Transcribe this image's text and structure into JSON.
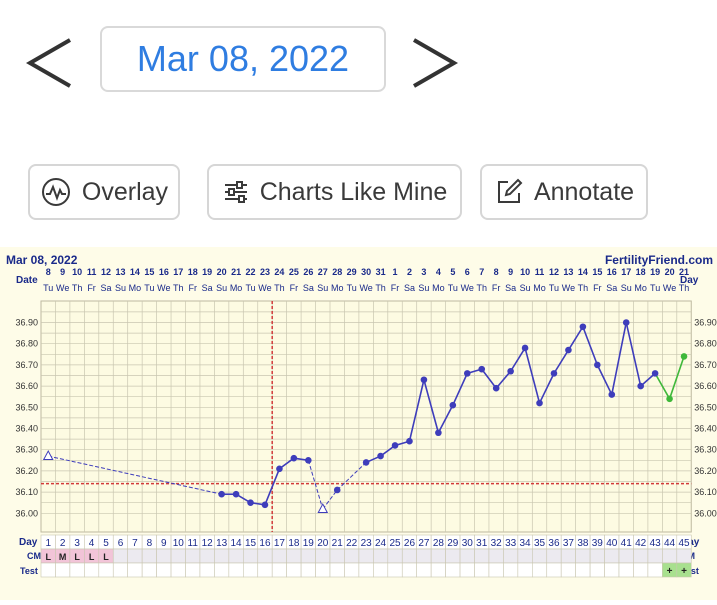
{
  "header": {
    "date": "Mar 08, 2022",
    "prev_icon": "chevron-left-icon",
    "next_icon": "chevron-right-icon"
  },
  "toolbar": {
    "overlay_label": "Overlay",
    "charts_like_mine_label": "Charts Like Mine",
    "annotate_label": "Annotate"
  },
  "chart_data": {
    "type": "line",
    "title": "Mar 08, 2022",
    "brand": "FertilityFriend.com",
    "row_labels": {
      "date": "Date",
      "day": "Day",
      "cm": "CM",
      "test": "Test"
    },
    "dates": [
      "8",
      "9",
      "10",
      "11",
      "12",
      "13",
      "14",
      "15",
      "16",
      "17",
      "18",
      "19",
      "20",
      "21",
      "22",
      "23",
      "24",
      "25",
      "26",
      "27",
      "28",
      "29",
      "30",
      "31",
      "1",
      "2",
      "3",
      "4",
      "5",
      "6",
      "7",
      "8",
      "9",
      "10",
      "11",
      "12",
      "13",
      "14",
      "15",
      "16",
      "17",
      "18",
      "19",
      "20",
      "21"
    ],
    "weekdays": [
      "Tu",
      "We",
      "Th",
      "Fr",
      "Sa",
      "Su",
      "Mo",
      "Tu",
      "We",
      "Th",
      "Fr",
      "Sa",
      "Su",
      "Mo",
      "Tu",
      "We",
      "Th",
      "Fr",
      "Sa",
      "Su",
      "Mo",
      "Tu",
      "We",
      "Th",
      "Fr",
      "Sa",
      "Su",
      "Mo",
      "Tu",
      "We",
      "Th",
      "Fr",
      "Sa",
      "Su",
      "Mo",
      "Tu",
      "We",
      "Th",
      "Fr",
      "Sa",
      "Su",
      "Mo",
      "Tu",
      "We",
      "Th"
    ],
    "cycle_days": [
      1,
      2,
      3,
      4,
      5,
      6,
      7,
      8,
      9,
      10,
      11,
      12,
      13,
      14,
      15,
      16,
      17,
      18,
      19,
      20,
      21,
      22,
      23,
      24,
      25,
      26,
      27,
      28,
      29,
      30,
      31,
      32,
      33,
      34,
      35,
      36,
      37,
      38,
      39,
      40,
      41,
      42,
      43,
      44,
      45
    ],
    "y_ticks": [
      "36.90",
      "36.80",
      "36.70",
      "36.60",
      "36.50",
      "36.40",
      "36.30",
      "36.20",
      "36.10",
      "36.00"
    ],
    "ylim": [
      35.94,
      36.98
    ],
    "coverline": 36.14,
    "ovulation_day": 16,
    "temperatures": [
      {
        "day": 1,
        "temp": 36.27,
        "open": true
      },
      {
        "day": 13,
        "temp": 36.09
      },
      {
        "day": 14,
        "temp": 36.09
      },
      {
        "day": 15,
        "temp": 36.05
      },
      {
        "day": 16,
        "temp": 36.04
      },
      {
        "day": 17,
        "temp": 36.21
      },
      {
        "day": 18,
        "temp": 36.26
      },
      {
        "day": 19,
        "temp": 36.25
      },
      {
        "day": 20,
        "temp": 36.02,
        "open": true
      },
      {
        "day": 21,
        "temp": 36.11
      },
      {
        "day": 23,
        "temp": 36.24
      },
      {
        "day": 24,
        "temp": 36.27
      },
      {
        "day": 25,
        "temp": 36.32
      },
      {
        "day": 26,
        "temp": 36.34
      },
      {
        "day": 27,
        "temp": 36.63
      },
      {
        "day": 28,
        "temp": 36.38
      },
      {
        "day": 29,
        "temp": 36.51
      },
      {
        "day": 30,
        "temp": 36.66
      },
      {
        "day": 31,
        "temp": 36.68
      },
      {
        "day": 32,
        "temp": 36.59
      },
      {
        "day": 33,
        "temp": 36.67
      },
      {
        "day": 34,
        "temp": 36.78
      },
      {
        "day": 35,
        "temp": 36.52
      },
      {
        "day": 36,
        "temp": 36.66
      },
      {
        "day": 37,
        "temp": 36.77
      },
      {
        "day": 38,
        "temp": 36.88
      },
      {
        "day": 39,
        "temp": 36.7
      },
      {
        "day": 40,
        "temp": 36.56
      },
      {
        "day": 41,
        "temp": 36.9
      },
      {
        "day": 42,
        "temp": 36.6
      },
      {
        "day": 43,
        "temp": 36.66
      },
      {
        "day": 44,
        "temp": 36.54,
        "pregnancy": true
      },
      {
        "day": 45,
        "temp": 36.74,
        "pregnancy": true
      }
    ],
    "cm": [
      {
        "day": 1,
        "value": "L"
      },
      {
        "day": 2,
        "value": "M"
      },
      {
        "day": 3,
        "value": "L"
      },
      {
        "day": 4,
        "value": "L"
      },
      {
        "day": 5,
        "value": "L"
      }
    ],
    "tests": [
      {
        "day": 44,
        "value": "+"
      },
      {
        "day": 45,
        "value": "+"
      }
    ],
    "colors": {
      "temp_line": "#3e3dbb",
      "pregnancy_line": "#3fb83a",
      "coverline": "#d23a3a",
      "grid": "#c9c6b0",
      "date": "#1a2a8a",
      "cm_bg": "#f2c4d8",
      "test_bg": "#a8e08f"
    }
  }
}
